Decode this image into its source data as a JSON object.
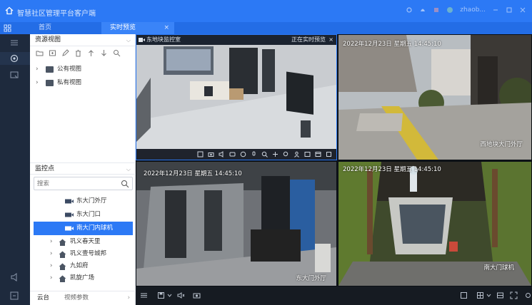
{
  "app": {
    "title": "智慧社区管理平台客户端",
    "user": "zhaob..."
  },
  "tabs": [
    {
      "label": "首页"
    },
    {
      "label": "实时预览",
      "close": "×"
    }
  ],
  "resource_panel": {
    "title": "资源视图",
    "tree": [
      {
        "label": "公有视图"
      },
      {
        "label": "私有视图"
      }
    ]
  },
  "monitor_panel": {
    "title": "监控点",
    "search_placeholder": "搜索",
    "cameras": [
      {
        "label": "东大门外厅"
      },
      {
        "label": "东大门口"
      },
      {
        "label": "南大门内球机",
        "selected": true
      }
    ],
    "sites": [
      {
        "label": "巩义春天里"
      },
      {
        "label": "巩义壹号城邦"
      },
      {
        "label": "九如府"
      },
      {
        "label": "凯旋广场"
      }
    ]
  },
  "ptz": {
    "tab1": "云台",
    "tab2": "视频参数"
  },
  "video_cells": [
    {
      "header": "东地块监控室",
      "status": "正在实时预览",
      "close": "×"
    },
    {
      "timestamp": "2022年12月23日  星期五  14:45:10",
      "name": "西地块大门外厅"
    },
    {
      "timestamp": "2022年12月23日  星期五  14:45:10",
      "name": "东大门外厅"
    },
    {
      "timestamp": "2022年12月23日  星期五  14:45:10",
      "name": "南大门球机"
    }
  ],
  "colors": {
    "accent": "#2c79f5",
    "titlebar": "#2c79f5",
    "sidebar": "#1e2a3d",
    "video_bg": "#0f1419"
  }
}
